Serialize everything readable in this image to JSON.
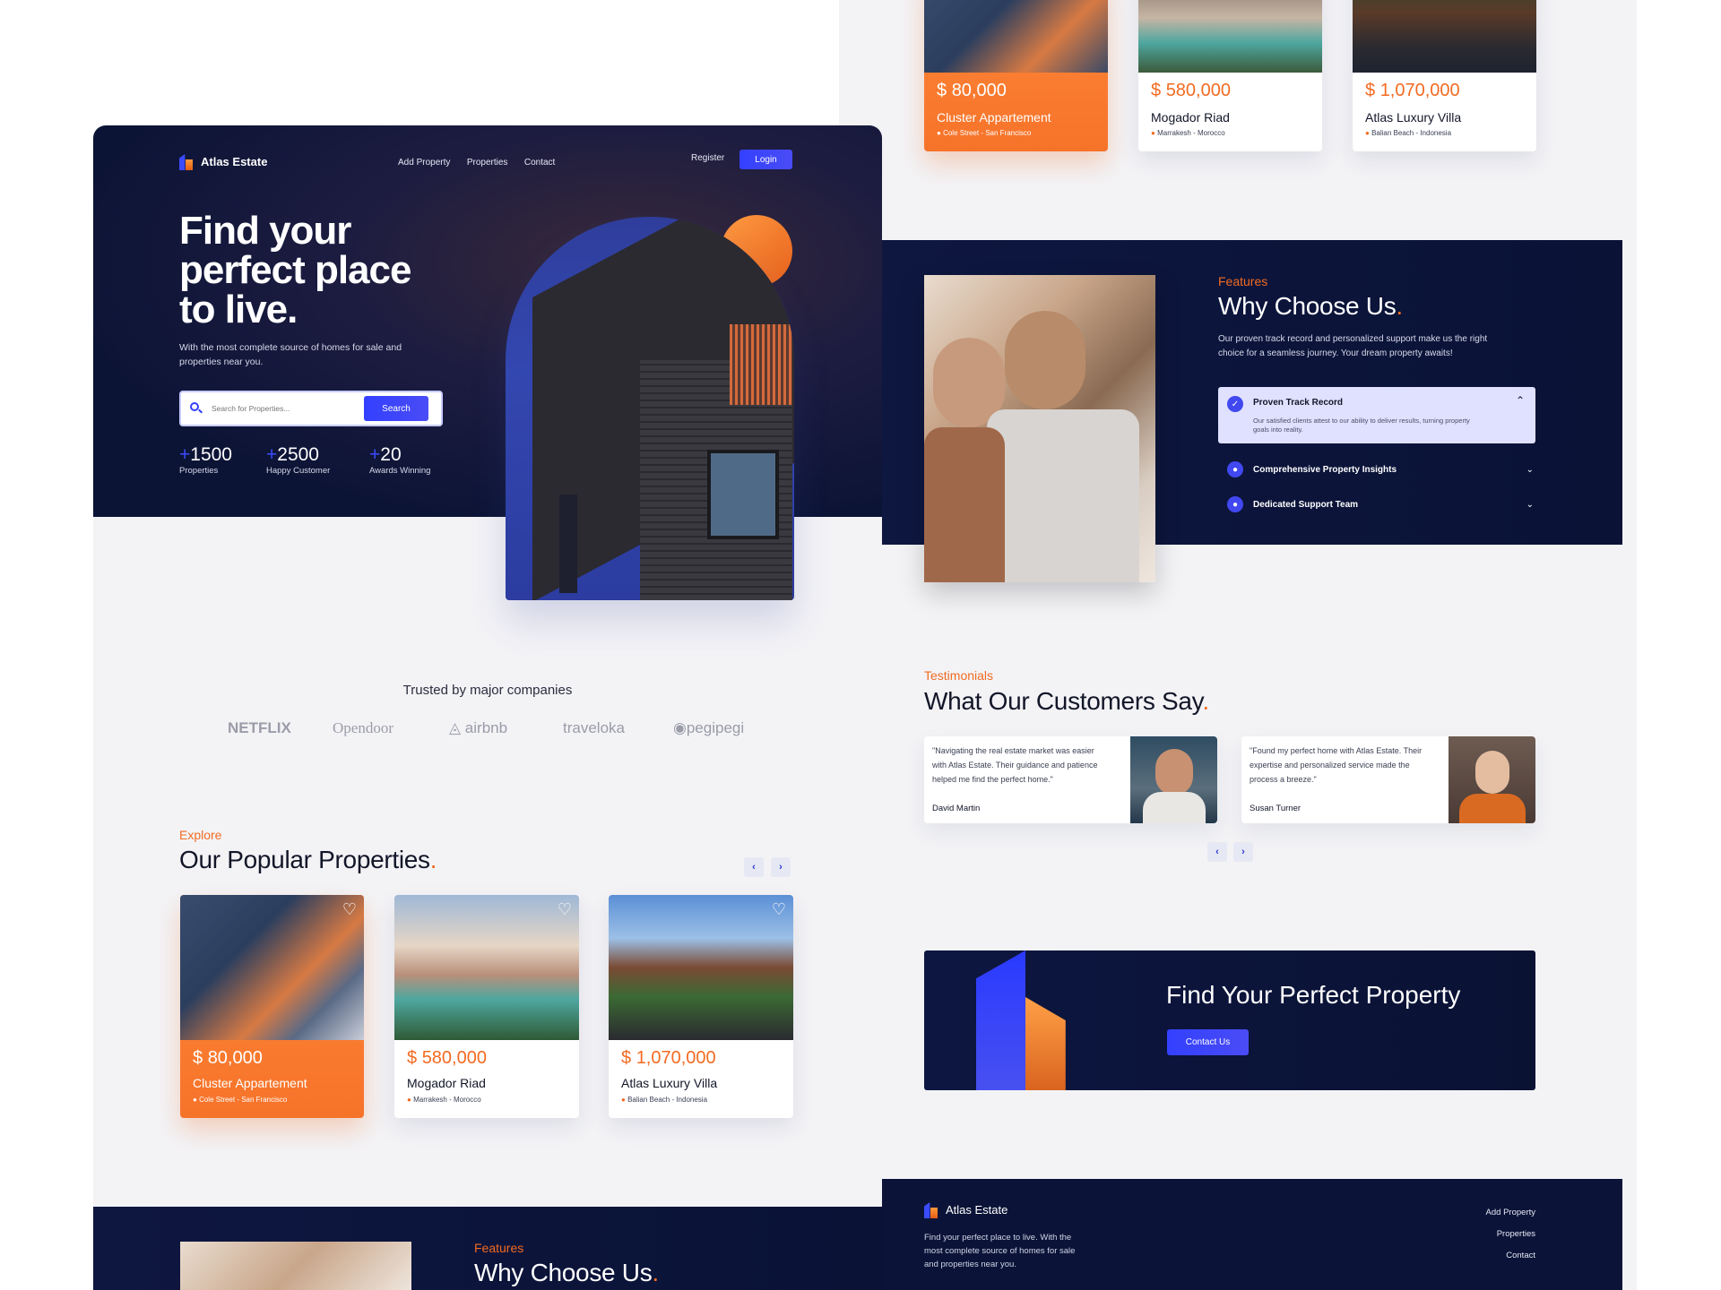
{
  "brand": {
    "name": "Atlas Estate"
  },
  "nav": {
    "items": [
      "Add Property",
      "Properties",
      "Contact"
    ],
    "register": "Register",
    "login": "Login"
  },
  "hero": {
    "title_lines": [
      "Find your",
      "perfect place",
      "to live."
    ],
    "subtitle_lines": [
      "With the most complete source of homes for sale and",
      "properties near you."
    ],
    "search_placeholder": "Search for Properties...",
    "search_button": "Search",
    "stats": [
      {
        "plus": "+",
        "value": "1500",
        "label": "Properties"
      },
      {
        "plus": "+",
        "value": "2500",
        "label": "Happy Customer"
      },
      {
        "plus": "+",
        "value": "20",
        "label": "Awards Winning"
      }
    ]
  },
  "trusted": {
    "title": "Trusted by major companies",
    "companies": [
      "NETFLIX",
      "Opendoor",
      "airbnb",
      "traveloka",
      "pegipegi"
    ]
  },
  "properties": {
    "eyebrow": "Explore",
    "title": "Our Popular Properties",
    "dot": ".",
    "prev": "‹",
    "next": "›",
    "cards": [
      {
        "price": "80,000",
        "currency": "$",
        "name": "Cluster Appartement",
        "location": "Cole Street - San Francisco"
      },
      {
        "price": "580,000",
        "currency": "$",
        "name": "Mogador Riad",
        "location": "Marrakesh - Morocco"
      },
      {
        "price": "1,070,000",
        "currency": "$",
        "name": "Atlas Luxury Villa",
        "location": "Balian Beach - Indonesia"
      }
    ]
  },
  "features": {
    "eyebrow": "Features",
    "title": "Why Choose Us",
    "dot": ".",
    "description_lines": [
      "Our proven track record and personalized support make us the right",
      "choice for a seamless journey. Your dream property awaits!"
    ],
    "items": [
      {
        "title": "Proven Track Record",
        "body_lines": [
          "Our satisfied clients attest to our ability to deliver results, turning property",
          "goals into reality."
        ],
        "expanded": true
      },
      {
        "title": "Comprehensive Property Insights",
        "expanded": false
      },
      {
        "title": "Dedicated Support Team",
        "expanded": false
      }
    ]
  },
  "testimonials": {
    "eyebrow": "Testimonials",
    "title": "What Our Customers Say",
    "dot": ".",
    "items": [
      {
        "quote_lines": [
          "\"Navigating the real estate market was easier",
          "with Atlas Estate. Their guidance and patience",
          "helped me find the perfect home.\""
        ],
        "name": "David Martin"
      },
      {
        "quote_lines": [
          "\"Found my perfect home with Atlas Estate. Their",
          "expertise and personalized service made the",
          "process a breeze.\""
        ],
        "name": "Susan Turner"
      }
    ],
    "prev": "‹",
    "next": "›"
  },
  "cta": {
    "title": "Find Your Perfect Property",
    "button": "Contact Us"
  },
  "footer": {
    "brand": "Atlas Estate",
    "text_lines": [
      "Find your perfect place to live. With the",
      "most complete source of homes for sale",
      "and properties near you."
    ],
    "links": [
      "Add Property",
      "Properties",
      "Contact"
    ]
  },
  "colors": {
    "navy": "#0c1436",
    "accent_orange": "#f26b22",
    "accent_blue": "#3b4bff"
  }
}
